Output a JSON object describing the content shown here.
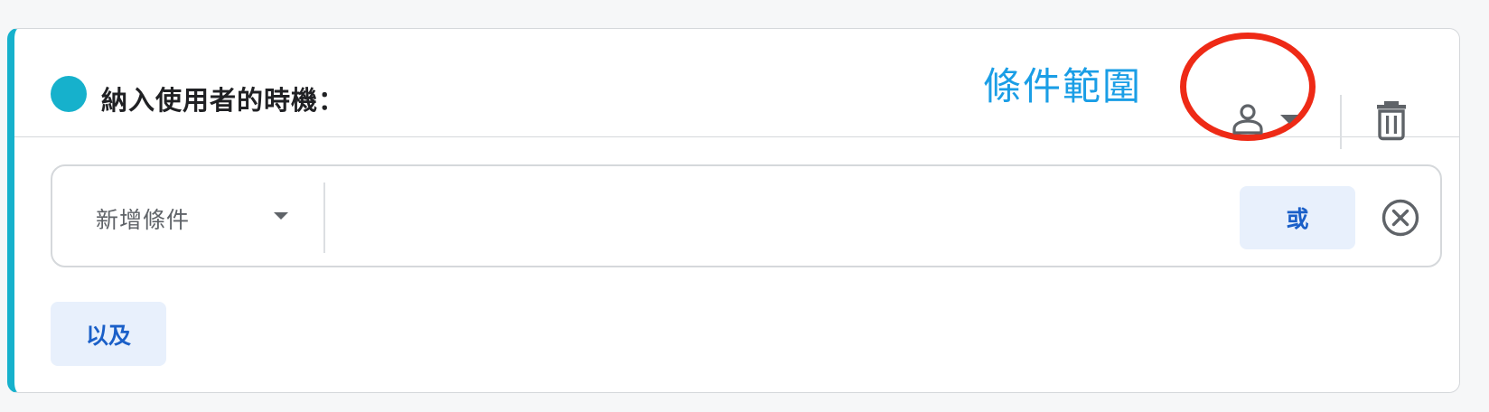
{
  "rule": {
    "title": "納入使用者的時機：",
    "accent_color": "#16b1cc",
    "scope_annotation": "條件範圍",
    "scope_annotation_color": "#1a9ee6",
    "highlight_color": "#ee2a16",
    "scope_icon": "person-icon",
    "delete_icon": "trash-icon"
  },
  "condition": {
    "select_label": "新增條件",
    "or_label": "或",
    "remove_icon": "circle-x-icon"
  },
  "and_label": "以及"
}
